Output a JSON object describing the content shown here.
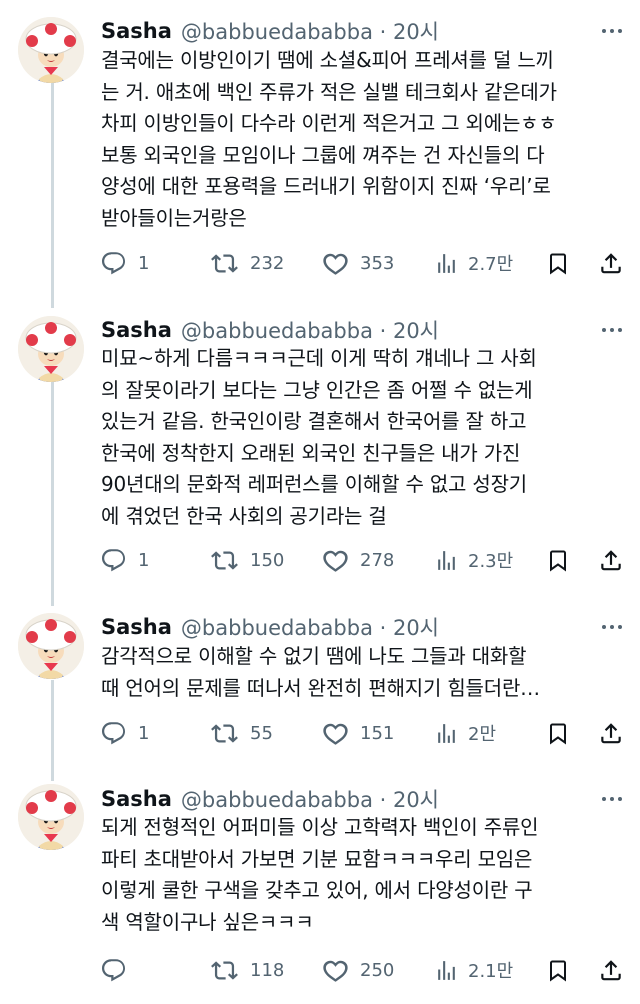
{
  "tweets": [
    {
      "name": "Sasha",
      "handle": "@babbuedababba · 20시",
      "lines": [
        "결국에는 이방인이기 땜에 소셜&피어 프레셔를 덜 느끼",
        "는 거. 애초에 백인 주류가 적은 실밸 테크회사 같은데가",
        "차피 이방인들이 다수라 이런게 적은거고 그 외에는ㅎㅎ",
        "보통 외국인을 모임이나 그룹에 껴주는 건 자신들의 다",
        "양성에 대한 포용력을 드러내기 위함이지 진짜 ‘우리’로",
        "받아들이는거랑은"
      ],
      "replies": "1",
      "retweets": "232",
      "likes": "353",
      "views": "2.7만"
    },
    {
      "name": "Sasha",
      "handle": "@babbuedababba · 20시",
      "lines": [
        "미묘~하게 다름ㅋㅋㅋ근데 이게 딱히 걔네나 그 사회",
        "의 잘못이라기 보다는 그냥 인간은 좀 어쩔 수 없는게",
        "있는거 같음. 한국인이랑 결혼해서 한국어를 잘 하고",
        "한국에 정착한지 오래된 외국인 친구들은 내가 가진",
        "90년대의 문화적 레퍼런스를 이해할 수 없고 성장기",
        "에 겪었던 한국 사회의 공기라는 걸"
      ],
      "replies": "1",
      "retweets": "150",
      "likes": "278",
      "views": "2.3만"
    },
    {
      "name": "Sasha",
      "handle": "@babbuedababba · 20시",
      "lines": [
        "감각적으로 이해할 수 없기 땜에 나도 그들과 대화할",
        "때 언어의 문제를 떠나서 완전히 편해지기 힘들더란…"
      ],
      "replies": "1",
      "retweets": "55",
      "likes": "151",
      "views": "2만"
    },
    {
      "name": "Sasha",
      "handle": "@babbuedababba · 20시",
      "lines": [
        "되게 전형적인 어퍼미들 이상 고학력자 백인이 주류인",
        "파티 초대받아서 가보면 기분 묘함ㅋㅋㅋ우리 모임은",
        "이렇게 쿨한 구색을 갖추고 있어, 에서 다양성이란 구",
        "색 역할이구나 싶은ㅋㅋㅋ"
      ],
      "replies": "",
      "retweets": "118",
      "likes": "250",
      "views": "2.1만"
    }
  ],
  "icons": {
    "reply": "reply-icon",
    "retweet": "retweet-icon",
    "like": "heart-icon",
    "views": "views-icon",
    "bookmark": "bookmark-icon",
    "share": "share-icon",
    "more": "more-icon",
    "avatar": "toad-avatar"
  },
  "colors": {
    "text": "#0f1419",
    "secondary": "#536471",
    "thread": "#cfd9de",
    "background": "#ffffff"
  }
}
